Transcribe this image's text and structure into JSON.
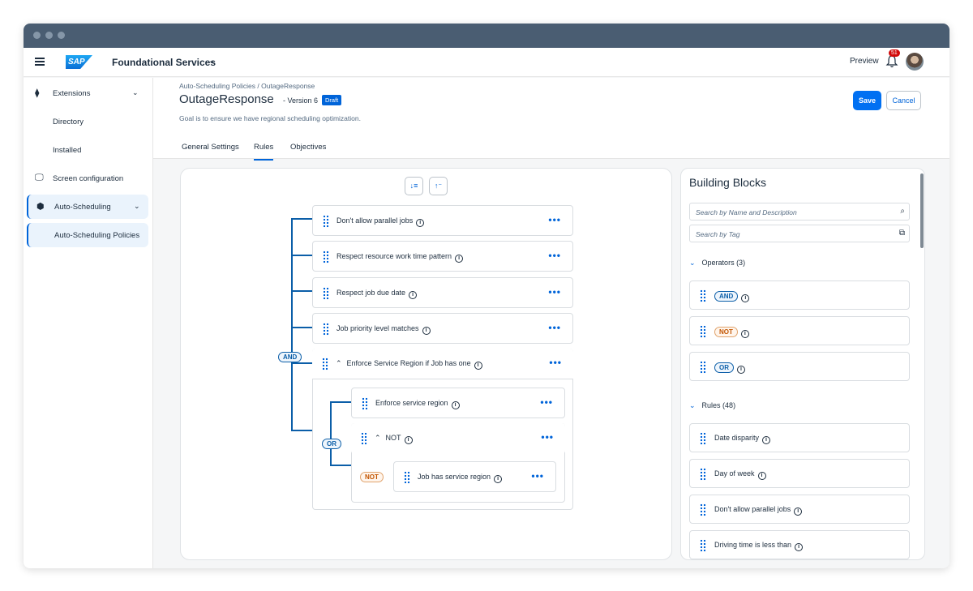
{
  "shell": {
    "logo_text": "SAP",
    "product": "Foundational Services",
    "preview": "Preview",
    "notifications": "51"
  },
  "sidebar": {
    "items": [
      {
        "label": "Extensions",
        "icon": "extensions-icon"
      },
      {
        "label": "Directory"
      },
      {
        "label": "Installed"
      },
      {
        "label": "Screen configuration",
        "icon": "monitor-icon"
      },
      {
        "label": "Auto-Scheduling",
        "icon": "cube-icon"
      },
      {
        "label": "Auto-Scheduling Policies"
      }
    ]
  },
  "header": {
    "breadcrumb": "Auto-Scheduling Policies / OutageResponse",
    "title": "OutageResponse",
    "version": "- Version 6",
    "status": "Draft",
    "goal": "Goal is to ensure we have regional scheduling optimization.",
    "save": "Save",
    "cancel": "Cancel",
    "tabs": [
      "General Settings",
      "Rules",
      "Objectives"
    ],
    "active_tab": "Rules"
  },
  "rules": {
    "root_operator": "AND",
    "items": [
      "Don't allow parallel jobs",
      "Respect resource work time pattern",
      "Respect job due date",
      "Job priority level matches"
    ],
    "group": {
      "label": "Enforce Service Region if Job has one",
      "operator": "OR",
      "child": "Enforce service region",
      "not_group": {
        "label": "NOT",
        "operator": "NOT",
        "child": "Job has service region"
      }
    }
  },
  "blocks": {
    "title": "Building Blocks",
    "search_name_placeholder": "Search by Name and Description",
    "search_tag_placeholder": "Search by Tag",
    "operators_header": "Operators (3)",
    "operators": [
      "AND",
      "NOT",
      "OR"
    ],
    "rules_header": "Rules (48)",
    "rules": [
      "Date disparity",
      "Day of week",
      "Don't allow parallel jobs",
      "Driving time is less than"
    ]
  },
  "colors": {
    "accent": "#0070f2",
    "titlebar": "#4a5d72",
    "connector": "#0b5ea8",
    "not_pill": "#c35500"
  }
}
